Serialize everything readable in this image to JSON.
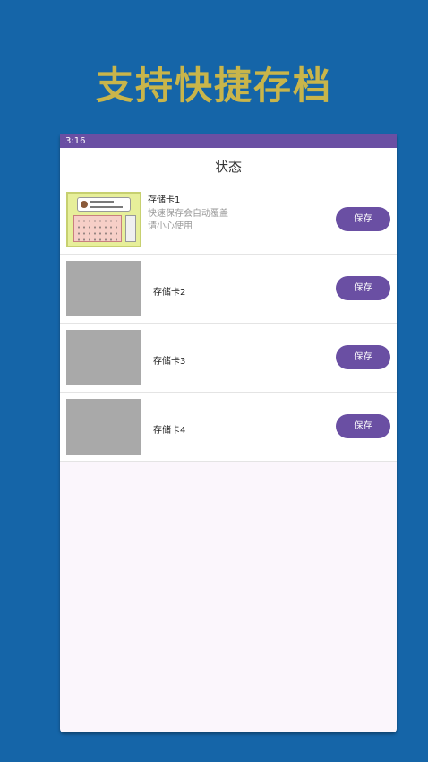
{
  "headline": "支持快捷存档",
  "status_bar": {
    "time": "3:16"
  },
  "app_bar": {
    "title": "状态"
  },
  "slots": [
    {
      "name": "存储卡1",
      "desc_line1": "快速保存会自动覆盖",
      "desc_line2": "请小心使用",
      "button": "保存",
      "has_thumbnail_image": true
    },
    {
      "name": "存储卡2",
      "button": "保存",
      "has_thumbnail_image": false
    },
    {
      "name": "存储卡3",
      "button": "保存",
      "has_thumbnail_image": false
    },
    {
      "name": "存储卡4",
      "button": "保存",
      "has_thumbnail_image": false
    }
  ],
  "colors": {
    "background": "#1565a8",
    "headline": "#c9b54a",
    "accent": "#6a4fa3",
    "screen": "#fbf6fc"
  }
}
